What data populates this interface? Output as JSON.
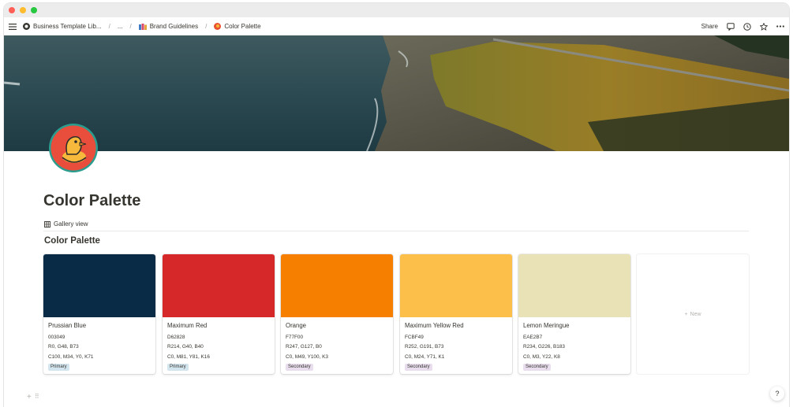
{
  "breadcrumb": {
    "workspace": "Business Template Lib...",
    "ellipsis": "...",
    "parent": "Brand Guidelines",
    "current": "Color Palette"
  },
  "topbar": {
    "share_label": "Share"
  },
  "page": {
    "title": "Color Palette"
  },
  "view": {
    "tab_label": "Gallery view",
    "gallery_title": "Color Palette"
  },
  "colors": [
    {
      "name": "Prussian Blue",
      "hex": "003049",
      "rgb": "R0, G48, B73",
      "cmyk": "C100, M34, Y0, K71",
      "tag": "Primary",
      "swatch": "#0a2b46"
    },
    {
      "name": "Maximum Red",
      "hex": "D62828",
      "rgb": "R214, G40, B40",
      "cmyk": "C0, M81, Y81, K16",
      "tag": "Primary",
      "swatch": "#d62828"
    },
    {
      "name": "Orange",
      "hex": "F77F00",
      "rgb": "R247, G127, B0",
      "cmyk": "C0, M49, Y100, K3",
      "tag": "Secondary",
      "swatch": "#f77f00"
    },
    {
      "name": "Maximum Yellow Red",
      "hex": "FCBF49",
      "rgb": "R252, G191, B73",
      "cmyk": "C0, M24, Y71, K1",
      "tag": "Secondary",
      "swatch": "#fcbf49"
    },
    {
      "name": "Lemon Meringue",
      "hex": "EAE2B7",
      "rgb": "R234, G226, B183",
      "cmyk": "C0, M3, Y22, K8",
      "tag": "Secondary",
      "swatch": "#eae2b7"
    }
  ],
  "tag_colors": {
    "Primary": "#d3e5ef",
    "Secondary": "#e8deee"
  },
  "new_label": "New",
  "help_label": "?"
}
